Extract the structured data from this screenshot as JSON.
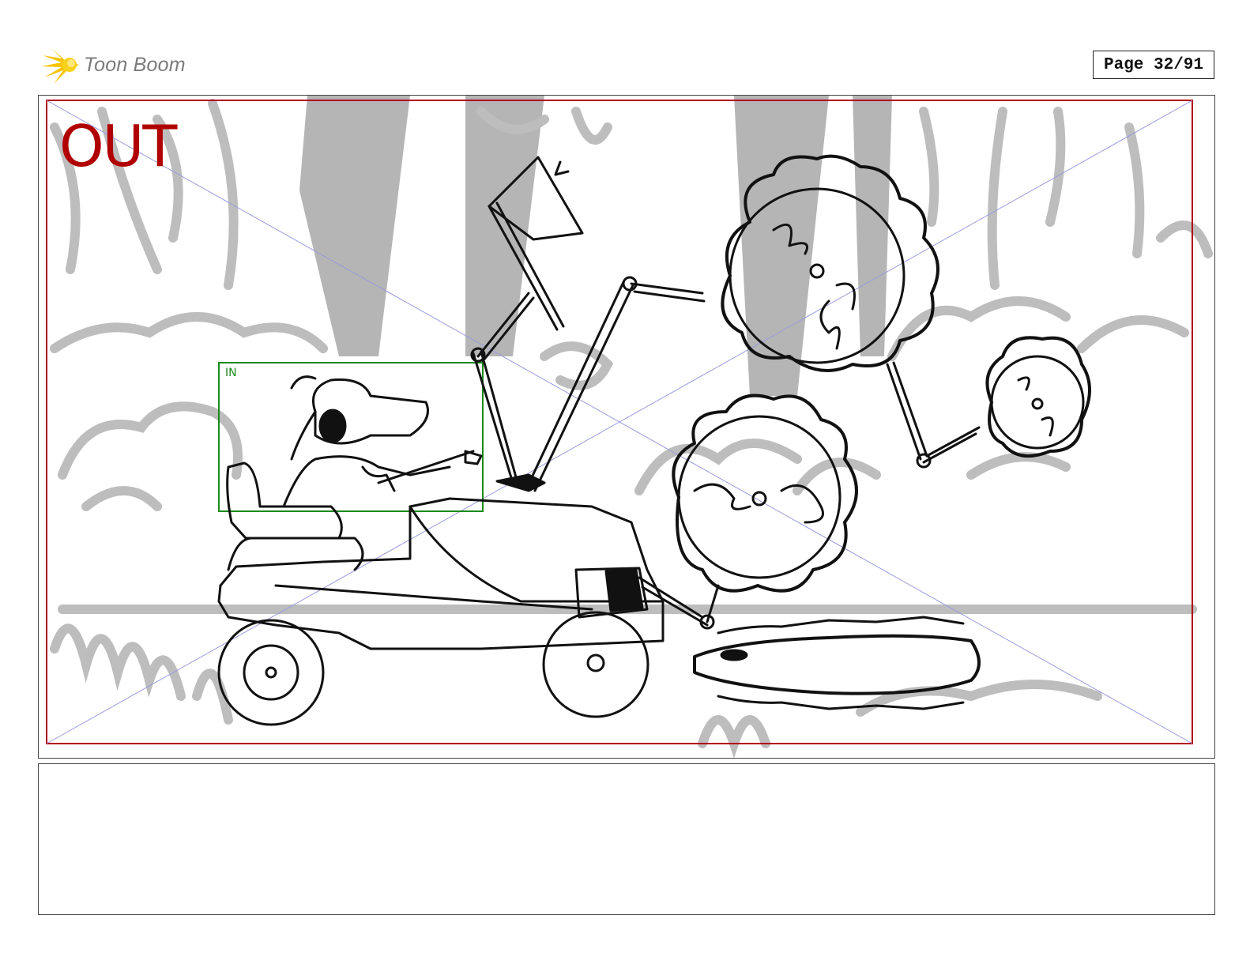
{
  "header": {
    "logo_text": "Toon Boom",
    "logo_icon": "starburst-icon",
    "page_label": "Page 32/91"
  },
  "panel": {
    "out_label": "OUT",
    "in_label": "IN"
  },
  "colors": {
    "out_frame": "#b00000",
    "in_frame": "#1a8a1a",
    "guides": "#9a9ae0",
    "background_sketch": "#bdbdbd",
    "tree_trunks": "#b5b5b5",
    "ink": "#111111",
    "logo_yellow": "#f5c400"
  },
  "notes": {
    "text": ""
  }
}
